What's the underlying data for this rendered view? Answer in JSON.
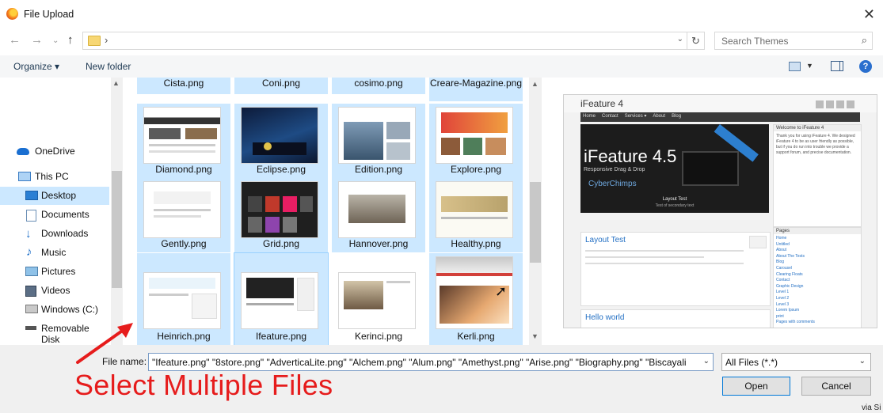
{
  "window": {
    "title": "File Upload"
  },
  "address": {
    "separator": "›"
  },
  "search": {
    "placeholder": "Search Themes"
  },
  "toolbar": {
    "organize": "Organize ▾",
    "new_folder": "New folder"
  },
  "nav": {
    "items": [
      {
        "label": "OneDrive",
        "icon": "cloud-icon"
      },
      {
        "label": "This PC",
        "icon": "computer-icon"
      },
      {
        "label": "Desktop",
        "icon": "desktop-icon",
        "selected": true
      },
      {
        "label": "Documents",
        "icon": "documents-icon"
      },
      {
        "label": "Downloads",
        "icon": "download-icon"
      },
      {
        "label": "Music",
        "icon": "music-icon"
      },
      {
        "label": "Pictures",
        "icon": "pictures-icon"
      },
      {
        "label": "Videos",
        "icon": "videos-icon"
      },
      {
        "label": "Windows (C:)",
        "icon": "drive-icon"
      },
      {
        "label": "Removable Disk",
        "icon": "usb-drive-icon"
      }
    ]
  },
  "files": {
    "row0": [
      "Cista.png",
      "Coni.png",
      "cosimo.png",
      "Creare-Magazine.png"
    ],
    "row1": [
      "Diamond.png",
      "Eclipse.png",
      "Edition.png",
      "Explore.png"
    ],
    "row2": [
      "Gently.png",
      "Grid.png",
      "Hannover.png",
      "Healthy.png"
    ],
    "row3": [
      "Heinrich.png",
      "Ifeature.png",
      "Kerinci.png",
      "Kerli.png"
    ]
  },
  "preview": {
    "site_title": "iFeature 4",
    "nav_links": [
      "Home",
      "Contact",
      "Services ▾",
      "About",
      "Blog"
    ],
    "slider_title": "iFeature 4.5",
    "slider_sub": "Responsive Drag & Drop",
    "slider_brand": "CyberChimps",
    "slider_caption": "Layout Test",
    "slider_caption_sub": "Test of secondary text",
    "welcome_title": "Welcome to iFeature 4",
    "welcome_text": "Thank you for using iFeature 4. We designed iFeature 4 to be as user friendly as possible, but if you do run into trouble we provide a support forum, and precise documentation.",
    "post1_title": "Layout Test",
    "post2_title": "Hello world",
    "pages_title": "Pages",
    "pages": [
      "Home",
      "Untitled",
      "About",
      "About The Tests",
      "Blog",
      "Carousel",
      "Clearing Floats",
      "Contact",
      "Graphic Design",
      "Level 1",
      "Level 2",
      "Level 3",
      "Lorem Ipsum",
      "print",
      "Pages with comments"
    ]
  },
  "bottom": {
    "filename_label": "File name:",
    "filename_value": "\"Ifeature.png\" \"8store.png\" \"AdverticaLite.png\" \"Alchem.png\" \"Alum.png\" \"Amethyst.png\" \"Arise.png\" \"Biography.png\" \"Biscayali",
    "filter_value": "All Files (*.*)",
    "open_label": "Open",
    "cancel_label": "Cancel"
  },
  "annotation": {
    "text": "Select Multiple Files",
    "color": "#e61c1c"
  },
  "footer": {
    "via": "via Si"
  },
  "colors": {
    "selection": "#cce8ff",
    "accent": "#0078d7"
  }
}
